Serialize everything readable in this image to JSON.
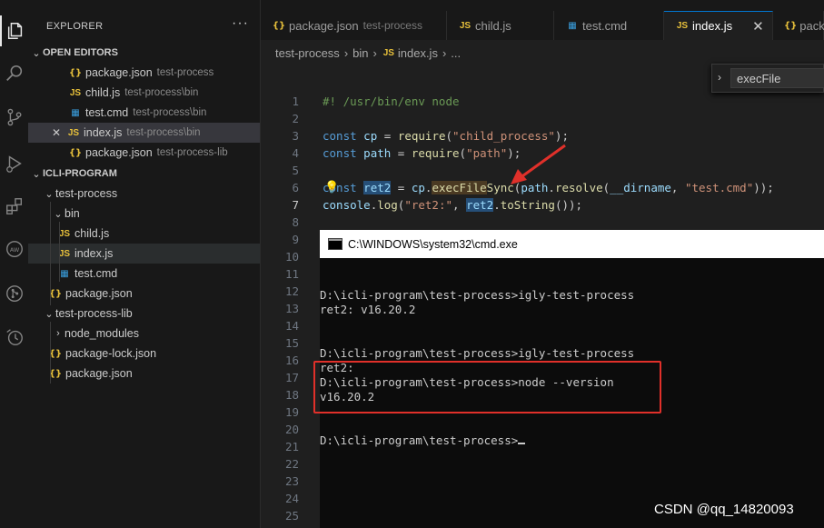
{
  "activity": [
    "explorer-icon",
    "search-icon",
    "source-control-icon",
    "run-debug-icon",
    "extensions-icon",
    "remote-icon",
    "git-graph-icon",
    "timeline-icon"
  ],
  "explorer": {
    "title": "EXPLORER",
    "more": "···",
    "open_editors": {
      "header": "OPEN EDITORS",
      "items": [
        {
          "icon": "{}",
          "type": "json",
          "name": "package.json",
          "desc": "test-process"
        },
        {
          "icon": "JS",
          "type": "js",
          "name": "child.js",
          "desc": "test-process\\bin"
        },
        {
          "icon": "▦",
          "type": "cmd",
          "name": "test.cmd",
          "desc": "test-process\\bin"
        },
        {
          "icon": "JS",
          "type": "js",
          "name": "index.js",
          "desc": "test-process\\bin",
          "close": "✕"
        },
        {
          "icon": "{}",
          "type": "json",
          "name": "package.json",
          "desc": "test-process-lib"
        }
      ]
    },
    "project": {
      "header": "ICLI-PROGRAM",
      "tree": [
        {
          "chev": "⌄",
          "name": "test-process"
        },
        {
          "chev": "⌄",
          "name": "bin"
        },
        {
          "icon": "JS",
          "name": "child.js"
        },
        {
          "icon": "JS",
          "name": "index.js"
        },
        {
          "icon": "▦",
          "name": "test.cmd"
        },
        {
          "icon": "{}",
          "name": "package.json"
        },
        {
          "chev": "⌄",
          "name": "test-process-lib"
        },
        {
          "chev": "›",
          "name": "node_modules"
        },
        {
          "icon": "{}",
          "name": "package-lock.json"
        },
        {
          "icon": "{}",
          "name": "package.json"
        }
      ]
    }
  },
  "tabs": [
    {
      "icon": "{}",
      "name": "package.json",
      "desc": "test-process"
    },
    {
      "icon": "JS",
      "name": "child.js"
    },
    {
      "icon": "▦",
      "name": "test.cmd"
    },
    {
      "icon": "JS",
      "name": "index.js",
      "close": "✕"
    },
    {
      "icon": "{}",
      "name": "pack"
    }
  ],
  "breadcrumb": [
    "test-process",
    "›",
    "bin",
    "›",
    "JS",
    "index.js",
    "›",
    "..."
  ],
  "find": {
    "chevron": "›",
    "value": "execFile"
  },
  "editor": {
    "line_numbers": [
      "1",
      "2",
      "3",
      "4",
      "5",
      "6",
      "7",
      "8",
      "9",
      "10",
      "11",
      "12",
      "13",
      "14",
      "15",
      "16",
      "17",
      "18",
      "19",
      "20",
      "21",
      "22",
      "23",
      "24",
      "25"
    ],
    "code": {
      "l1": "#! /usr/bin/env node",
      "l3_kw": "const",
      "l3_var": "cp",
      "l3_eq": " = ",
      "l3_fn": "require",
      "l3_str": "\"child_process\"",
      "l3_end": ");",
      "l4_kw": "const",
      "l4_var": "path",
      "l4_eq": " = ",
      "l4_fn": "require",
      "l4_str": "\"path\"",
      "l4_end": ");",
      "l6_kw": "const",
      "l6_var": "ret2",
      "l6_eq": " = ",
      "l6_obj": "cp",
      "l6_dot": ".",
      "l6_fn": "execFile",
      "l6_fn2": "Sync",
      "l6_open": "(",
      "l6_path": "path",
      "l6_resolve": "resolve",
      "l6_dirname": "__dirname",
      "l6_comma": ", ",
      "l6_str": "\"test.cmd\"",
      "l6_end": "));",
      "l7_obj": "console",
      "l7_fn": "log",
      "l7_str": "\"ret2:\"",
      "l7_var": "ret2",
      "l7_fn2": "toString",
      "l7_end": "());"
    },
    "bulb": "💡"
  },
  "cmd": {
    "title": "C:\\WINDOWS\\system32\\cmd.exe",
    "lines": [
      "D:\\icli-program\\test-process>igly-test-process",
      "ret2: v16.20.2",
      "D:\\icli-program\\test-process>igly-test-process",
      "ret2:",
      "D:\\icli-program\\test-process>node --version",
      "v16.20.2",
      "D:\\icli-program\\test-process>"
    ]
  },
  "watermark": "CSDN @qq_14820093"
}
